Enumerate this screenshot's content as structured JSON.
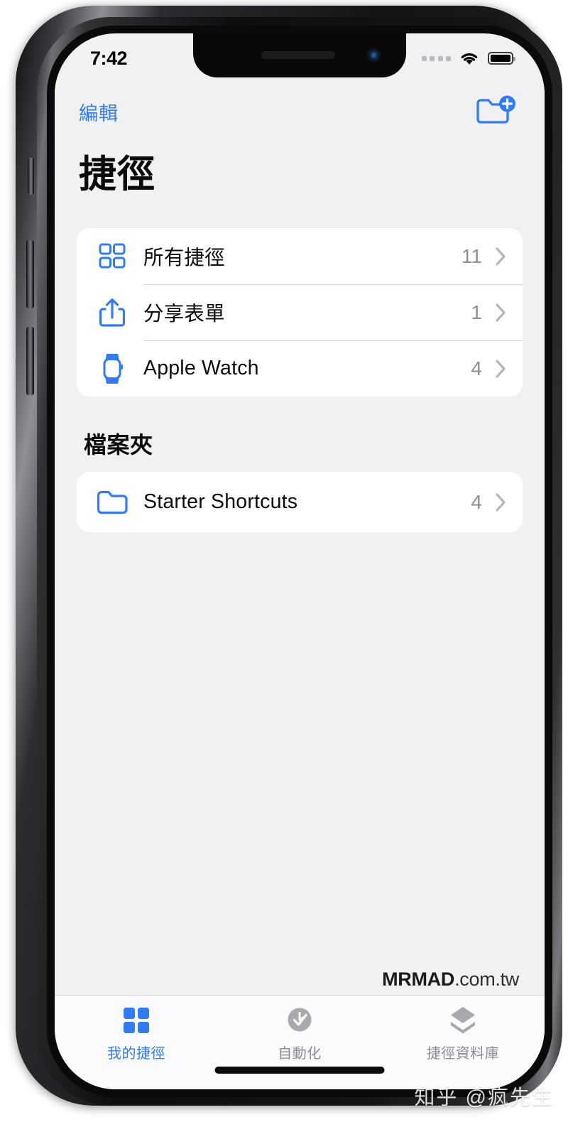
{
  "status_bar": {
    "time": "7:42",
    "signal_icon": "cellular-dots-icon",
    "wifi_icon": "wifi-icon",
    "battery_icon": "battery-full-icon"
  },
  "nav": {
    "edit_label": "編輯",
    "new_folder_icon": "new-folder-icon"
  },
  "page_title": "捷徑",
  "shortcut_lists": [
    {
      "icon": "grid-icon",
      "label": "所有捷徑",
      "count": "11",
      "chevron": "chevron-right-icon"
    },
    {
      "icon": "share-sheet-icon",
      "label": "分享表單",
      "count": "1",
      "chevron": "chevron-right-icon"
    },
    {
      "icon": "apple-watch-icon",
      "label": "Apple Watch",
      "count": "4",
      "chevron": "chevron-right-icon"
    }
  ],
  "folders_section": {
    "title": "檔案夾",
    "items": [
      {
        "icon": "folder-icon",
        "label": "Starter Shortcuts",
        "count": "4",
        "chevron": "chevron-right-icon"
      }
    ]
  },
  "watermark": {
    "brand_bold": "MRMAD",
    "brand_light": ".com.tw",
    "zhihu": "知乎 @疯先生"
  },
  "tab_bar": [
    {
      "icon": "grid-filled-icon",
      "label": "我的捷徑",
      "active": true
    },
    {
      "icon": "check-clock-icon",
      "label": "自動化",
      "active": false
    },
    {
      "icon": "layers-icon",
      "label": "捷徑資料庫",
      "active": false
    }
  ],
  "colors": {
    "accent": "#2f7cf6",
    "screen_bg": "#f1f1f4",
    "card_bg": "#ffffff",
    "secondary_text": "#8e8e93"
  }
}
